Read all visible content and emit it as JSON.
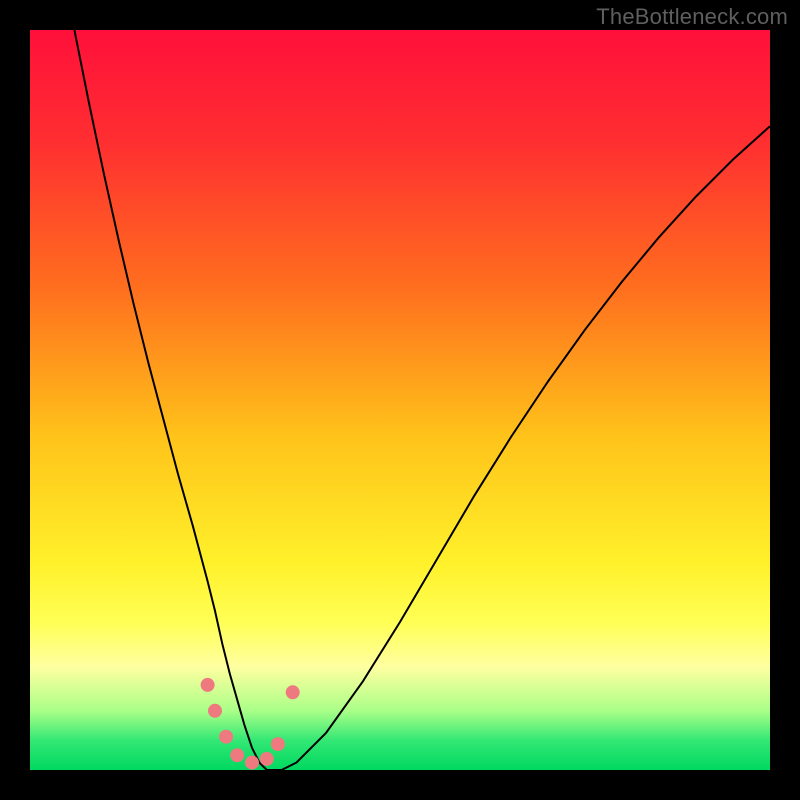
{
  "watermark": "TheBottleneck.com",
  "chart_data": {
    "type": "line",
    "title": "",
    "xlabel": "",
    "ylabel": "",
    "xlim": [
      0,
      100
    ],
    "ylim": [
      0,
      100
    ],
    "grid": false,
    "gradient_stops": [
      {
        "offset": 0.0,
        "color": "#ff103a"
      },
      {
        "offset": 0.15,
        "color": "#ff2e31"
      },
      {
        "offset": 0.35,
        "color": "#ff6f1e"
      },
      {
        "offset": 0.55,
        "color": "#ffc31a"
      },
      {
        "offset": 0.72,
        "color": "#fff12a"
      },
      {
        "offset": 0.8,
        "color": "#ffff55"
      },
      {
        "offset": 0.86,
        "color": "#ffffa0"
      },
      {
        "offset": 0.92,
        "color": "#aaff88"
      },
      {
        "offset": 0.96,
        "color": "#33e874"
      },
      {
        "offset": 1.0,
        "color": "#00d860"
      }
    ],
    "series": [
      {
        "name": "bottleneck-curve",
        "stroke": "#000000",
        "x": [
          6,
          8,
          10,
          12,
          14,
          16,
          18,
          20,
          22,
          24,
          25,
          26,
          27,
          28,
          29,
          30,
          31,
          32,
          34,
          36,
          40,
          45,
          50,
          55,
          60,
          65,
          70,
          75,
          80,
          85,
          90,
          95,
          100
        ],
        "y": [
          100,
          90,
          80.5,
          71.5,
          63,
          55,
          47.5,
          40,
          33,
          25.5,
          21.5,
          17,
          13,
          9.5,
          6,
          3,
          1,
          0,
          0,
          1,
          5,
          12,
          20,
          28.5,
          37,
          45,
          52.5,
          59.5,
          66,
          72,
          77.5,
          82.5,
          87
        ]
      }
    ],
    "annotations": {
      "dots": {
        "color": "#ee7a80",
        "radius_px": 7,
        "points": [
          {
            "x": 24.0,
            "y": 11.5
          },
          {
            "x": 25.0,
            "y": 8.0
          },
          {
            "x": 26.5,
            "y": 4.5
          },
          {
            "x": 28.0,
            "y": 2.0
          },
          {
            "x": 30.0,
            "y": 1.0
          },
          {
            "x": 32.0,
            "y": 1.5
          },
          {
            "x": 33.5,
            "y": 3.5
          },
          {
            "x": 35.5,
            "y": 10.5
          }
        ]
      }
    }
  }
}
